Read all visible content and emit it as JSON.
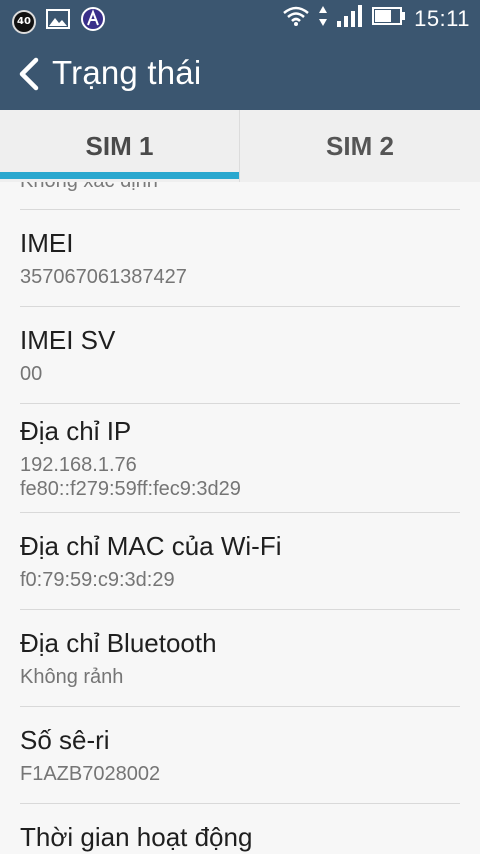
{
  "status_bar": {
    "notification_badge": "40",
    "time": "15:11",
    "icons": [
      "notification-count-icon",
      "image-icon",
      "app-notification-icon",
      "wifi-icon",
      "data-arrows-icon",
      "signal-icon",
      "battery-icon"
    ]
  },
  "app_bar": {
    "title": "Trạng thái",
    "back_icon": "chevron-left-icon"
  },
  "tabs": [
    {
      "label": "SIM 1",
      "selected": true
    },
    {
      "label": "SIM 2",
      "selected": false
    }
  ],
  "list": {
    "partial_top_value": "Không xác định",
    "items": [
      {
        "title": "IMEI",
        "values": [
          "357067061387427"
        ]
      },
      {
        "title": "IMEI SV",
        "values": [
          "00"
        ]
      },
      {
        "title": "Địa chỉ IP",
        "values": [
          "192.168.1.76",
          "fe80::f279:59ff:fec9:3d29"
        ]
      },
      {
        "title": "Địa chỉ MAC của Wi-Fi",
        "values": [
          "f0:79:59:c9:3d:29"
        ]
      },
      {
        "title": "Địa chỉ Bluetooth",
        "values": [
          "Không rảnh"
        ]
      },
      {
        "title": "Số sê-ri",
        "values": [
          "F1AZB7028002"
        ]
      },
      {
        "title": "Thời gian hoạt động",
        "values": []
      }
    ]
  },
  "colors": {
    "app_bar": "#3b5670",
    "tab_indicator": "#2aa8cf",
    "background": "#f7f7f7"
  }
}
